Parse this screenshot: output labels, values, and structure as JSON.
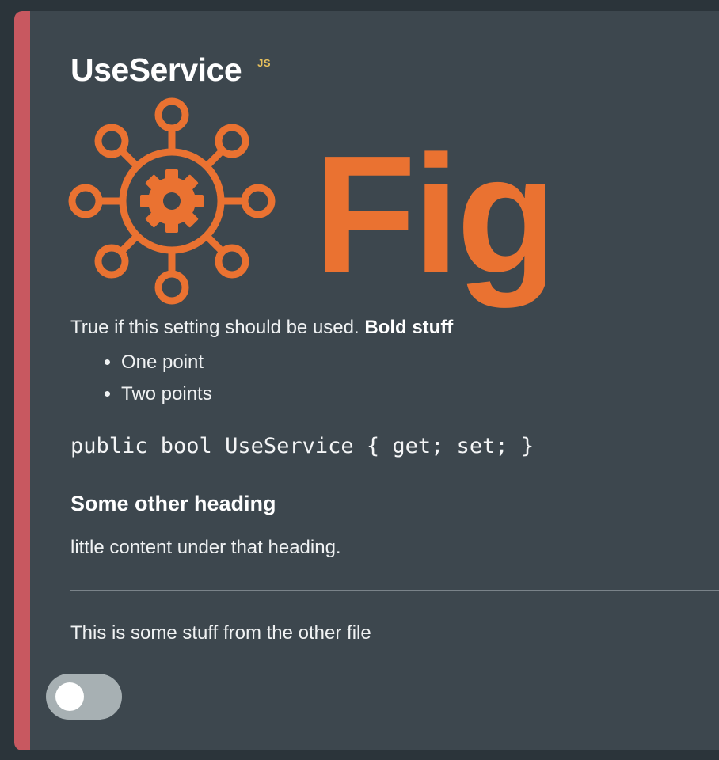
{
  "setting": {
    "name": "UseService",
    "badge": "JS",
    "logo_text": "Fig",
    "description_plain": "True if this setting should be used. ",
    "description_bold": "Bold stuff",
    "bullet_points": [
      "One point",
      "Two points"
    ],
    "code_signature": "public bool UseService { get; set; }",
    "subheading": "Some other heading",
    "subheading_content": "little content under that heading.",
    "other_file_text": "This is some stuff from the other file",
    "toggle_state": "off"
  },
  "colors": {
    "accent_bar": "#c85860",
    "card_background": "#3d474e",
    "page_background": "#2b343a",
    "logo_orange": "#ea7231",
    "badge_yellow": "#e8c15c",
    "toggle_track": "#a7b0b3"
  },
  "icons": {
    "logo": "network-gear-icon"
  }
}
